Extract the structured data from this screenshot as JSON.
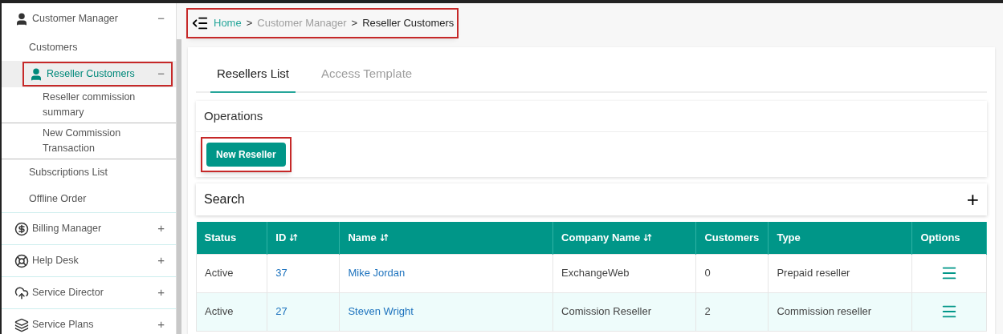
{
  "sidebar": {
    "items": [
      {
        "label": "Customer Manager",
        "kind": "user",
        "toggle": "−",
        "selected": false,
        "highlighted": false,
        "children": [
          {
            "label": "Customers",
            "selected": false,
            "highlighted": false
          },
          {
            "label": "Reseller Customers",
            "kind": "user",
            "toggle": "−",
            "selected": true,
            "highlighted": true,
            "children": [
              {
                "label": "Reseller commission summary",
                "selected": false,
                "highlighted": false
              },
              {
                "label": "New Commission Transaction",
                "selected": false,
                "highlighted": false
              }
            ]
          },
          {
            "label": "Subscriptions List",
            "selected": false,
            "highlighted": false
          },
          {
            "label": "Offline Order",
            "selected": false,
            "highlighted": false
          }
        ]
      },
      {
        "label": "Billing Manager",
        "kind": "dollar",
        "toggle": "+",
        "selected": false,
        "highlighted": false
      },
      {
        "label": "Help Desk",
        "kind": "lifebuoy",
        "toggle": "+",
        "selected": false,
        "highlighted": false
      },
      {
        "label": "Service Director",
        "kind": "cloud",
        "toggle": "+",
        "selected": false,
        "highlighted": false
      },
      {
        "label": "Service Plans",
        "kind": "plans",
        "toggle": "+",
        "selected": false,
        "highlighted": false
      }
    ]
  },
  "breadcrumb": {
    "highlighted": true,
    "items": [
      {
        "label": "Home",
        "kind": "link"
      },
      {
        "label": ">",
        "kind": "sep"
      },
      {
        "label": "Customer Manager",
        "kind": "muted"
      },
      {
        "label": ">",
        "kind": "sep"
      },
      {
        "label": "Reseller Customers",
        "kind": "current"
      }
    ]
  },
  "tabs": [
    {
      "label": "Resellers List",
      "selected": true
    },
    {
      "label": "Access Template",
      "selected": false
    }
  ],
  "operations": {
    "title": "Operations",
    "button": {
      "label": "New Reseller",
      "highlighted": true
    }
  },
  "search": {
    "title": "Search",
    "toggle": "+"
  },
  "table": {
    "columns": [
      {
        "label": "Status",
        "sortable": false
      },
      {
        "label": "ID",
        "sortable": true
      },
      {
        "label": "Name",
        "sortable": true
      },
      {
        "label": "Company Name",
        "sortable": true
      },
      {
        "label": "Customers",
        "sortable": false
      },
      {
        "label": "Type",
        "sortable": false
      },
      {
        "label": "Options",
        "sortable": false
      }
    ],
    "rows": [
      {
        "status": "Active",
        "id": "37",
        "name": "Mike Jordan",
        "company": "ExchangeWeb",
        "customers": "0",
        "type": "Prepaid reseller"
      },
      {
        "status": "Active",
        "id": "27",
        "name": "Steven Wright",
        "company": "Comission Reseller",
        "customers": "2",
        "type": "Commission reseller"
      }
    ]
  }
}
